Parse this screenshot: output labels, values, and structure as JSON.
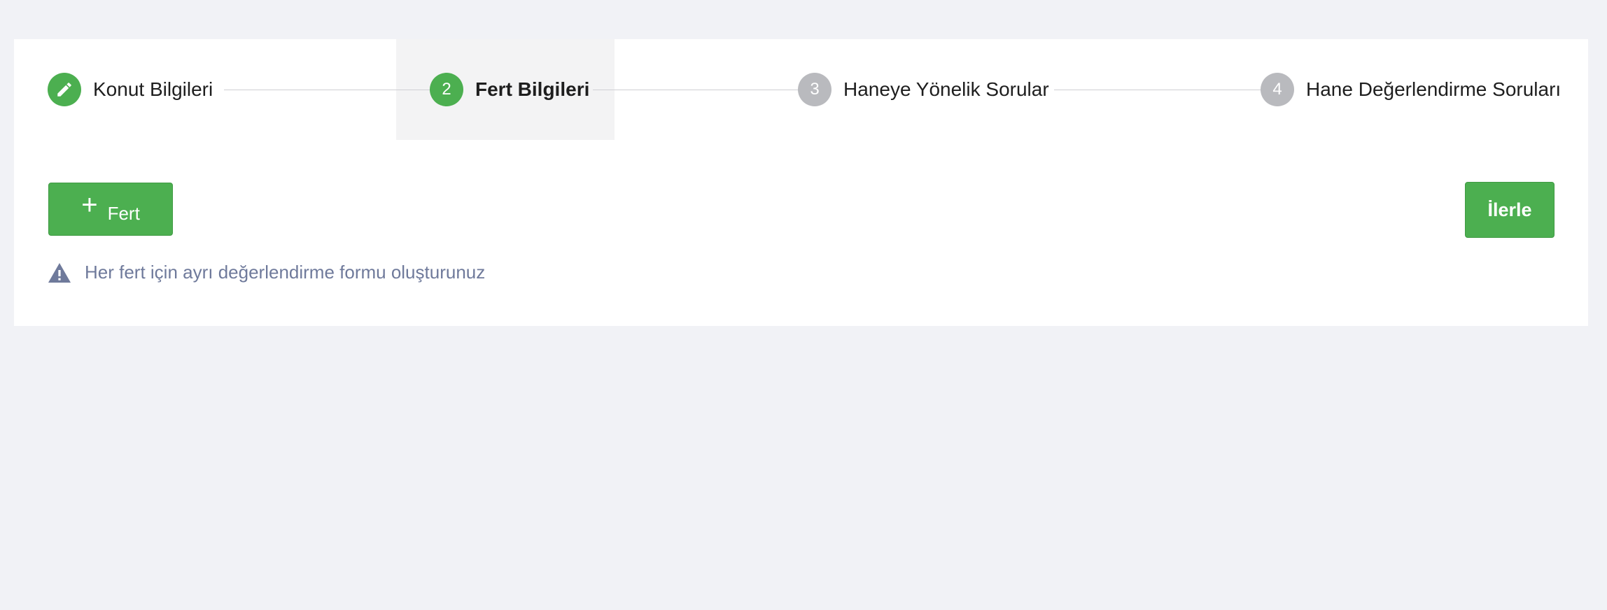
{
  "stepper": {
    "steps": [
      {
        "number": "",
        "label": "Konut Bilgileri",
        "status": "completed",
        "icon": "pencil-icon"
      },
      {
        "number": "2",
        "label": "Fert Bilgileri",
        "status": "active"
      },
      {
        "number": "3",
        "label": "Haneye Yönelik Sorular",
        "status": "pending"
      },
      {
        "number": "4",
        "label": "Hane Değerlendirme Soruları",
        "status": "pending"
      }
    ]
  },
  "actions": {
    "add_label": "Fert",
    "add_icon": "plus-icon",
    "next_label": "İlerle"
  },
  "hint": {
    "icon": "warning-icon",
    "text": "Her fert için ayrı değerlendirme formu oluşturunuz"
  },
  "colors": {
    "accent": "#4caf50",
    "pending": "#b9babe",
    "hint_text": "#6f7a9b",
    "background": "#f1f2f6"
  }
}
